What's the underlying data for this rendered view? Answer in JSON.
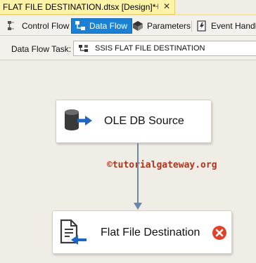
{
  "document_tab": {
    "title": "FLAT FILE DESTINATION.dtsx [Design]*",
    "pin_glyph": "⊣",
    "close_glyph": "✕"
  },
  "designer_tabs": [
    {
      "label": "Control Flow",
      "icon": "control-flow-icon",
      "active": false
    },
    {
      "label": "Data Flow",
      "icon": "data-flow-icon",
      "active": true
    },
    {
      "label": "Parameters",
      "icon": "parameters-icon",
      "active": false
    },
    {
      "label": "Event Handlers",
      "icon": "event-handlers-icon",
      "active": false
    }
  ],
  "task_row": {
    "label": "Data Flow Task:",
    "selected_value": "SSIS FLAT FILE DESTINATION"
  },
  "components": {
    "source": {
      "label": "OLE DB Source",
      "icon": "ole-db-source-icon"
    },
    "destination": {
      "label": "Flat File Destination",
      "icon": "flat-file-destination-icon",
      "status": "error",
      "status_icon": "error-icon"
    }
  },
  "watermark": "©tutorialgateway.org",
  "colors": {
    "doc_tab_bg": "#fff3a8",
    "active_tab_bg": "#1a82d6",
    "canvas_bg": "#f0ede6",
    "path_arrow": "#6a87ad",
    "error_red": "#e0412a",
    "watermark": "#b0351e"
  }
}
